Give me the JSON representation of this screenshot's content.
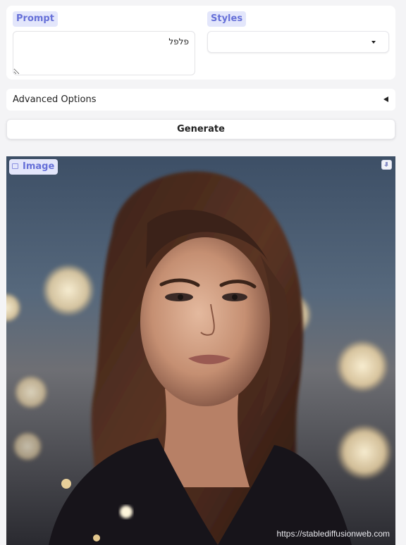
{
  "prompt": {
    "label": "Prompt",
    "value": "פלפל"
  },
  "styles": {
    "label": "Styles",
    "selected": ""
  },
  "advanced": {
    "label": "Advanced Options"
  },
  "generate": {
    "label": "Generate"
  },
  "output": {
    "label": "Image",
    "watermark": "https://stablediffusionweb.com"
  },
  "colors": {
    "accent": "#6670d8",
    "tag_bg": "#e3e6fb"
  },
  "icons": [
    "image-icon",
    "download-icon",
    "dropdown-caret-icon",
    "accordion-collapse-icon"
  ]
}
